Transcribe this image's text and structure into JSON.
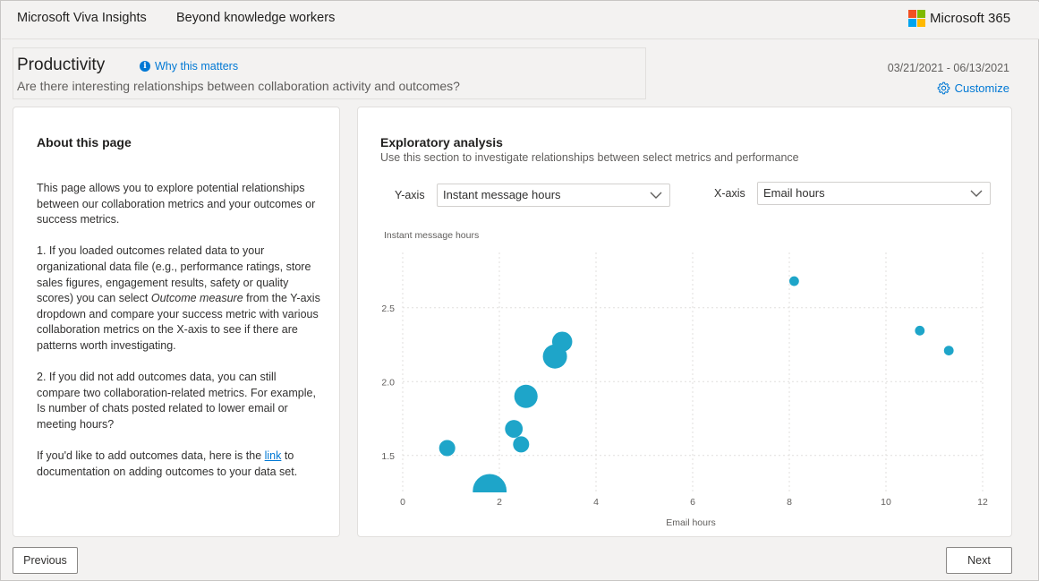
{
  "app": {
    "name": "Microsoft Viva Insights",
    "tab": "Beyond knowledge workers",
    "brand": "Microsoft 365",
    "brand_logo_colors": [
      "#f25022",
      "#7fba00",
      "#00a4ef",
      "#ffb900"
    ]
  },
  "header": {
    "title": "Productivity",
    "why_link": "Why this matters",
    "info_icon": "info-icon",
    "subtitle": "Are there interesting relationships between collaboration activity and outcomes?",
    "date_range": "03/21/2021 - 06/13/2021",
    "customize_label": "Customize",
    "customize_icon": "gear-icon"
  },
  "about": {
    "title": "About this page",
    "p1": "This page allows you to explore potential relationships between our collaboration metrics and your outcomes or success metrics.",
    "p2_a": "1. If you loaded outcomes related data to your organizational data file (e.g., performance ratings, store sales figures, engagement results, safety or quality scores) you can select ",
    "p2_em": "Outcome measure",
    "p2_b": " from the Y-axis dropdown and compare your success metric with various collaboration metrics on the X-axis to see if there are patterns worth investigating.",
    "p3": "2. If you did not add outcomes data, you can still compare two collaboration-related metrics.  For example, Is number of chats posted related to lower email or meeting hours?",
    "p4_a": "If you'd like to add outcomes data, here is the ",
    "p4_link": "link",
    "p4_b": " to documentation on adding outcomes to your data set."
  },
  "analysis": {
    "title": "Exploratory analysis",
    "description": "Use this section to investigate relationships between select metrics and performance",
    "y_axis_label": "Y-axis",
    "y_axis_value": "Instant message hours",
    "x_axis_label": "X-axis",
    "x_axis_value": "Email hours"
  },
  "chart_data": {
    "type": "scatter",
    "title": "",
    "ylabel": "Instant message hours",
    "xlabel": "Email hours",
    "xlim": [
      0,
      12
    ],
    "ylim": [
      1.25,
      2.85
    ],
    "x_ticks": [
      0,
      2,
      4,
      6,
      8,
      10,
      12
    ],
    "y_ticks": [
      1.5,
      2.0,
      2.5
    ],
    "y_tick_labels": [
      "1.5",
      "2.0",
      "2.5"
    ],
    "grid": true,
    "color": "#1ea5c9",
    "points": [
      {
        "x": 0.92,
        "y": 1.55,
        "size": 1.0
      },
      {
        "x": 1.8,
        "y": 1.26,
        "size": 2.1
      },
      {
        "x": 2.3,
        "y": 1.68,
        "size": 1.1
      },
      {
        "x": 2.45,
        "y": 1.575,
        "size": 1.0
      },
      {
        "x": 2.55,
        "y": 1.9,
        "size": 1.45
      },
      {
        "x": 3.15,
        "y": 2.17,
        "size": 1.5
      },
      {
        "x": 3.3,
        "y": 2.27,
        "size": 1.25
      },
      {
        "x": 8.1,
        "y": 2.68,
        "size": 0.6
      },
      {
        "x": 10.7,
        "y": 2.345,
        "size": 0.6
      },
      {
        "x": 11.3,
        "y": 2.21,
        "size": 0.6
      }
    ]
  },
  "footer": {
    "previous_label": "Previous",
    "next_label": "Next"
  }
}
